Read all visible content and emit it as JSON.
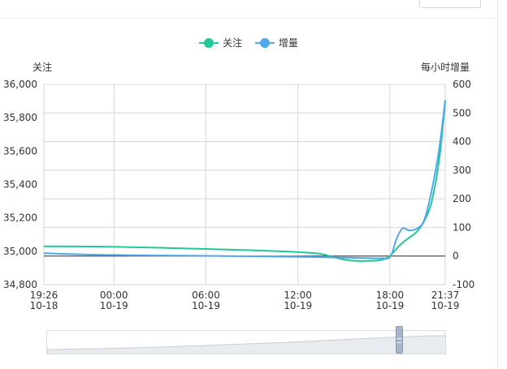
{
  "header": {
    "title": "",
    "button_label": ""
  },
  "legend": [
    {
      "name": "关注",
      "color": "#20c997"
    },
    {
      "name": "增量",
      "color": "#4fa8e8"
    }
  ],
  "colors": {
    "followers": "#20c997",
    "increment": "#4fa8e8",
    "grid": "#d6d6d6",
    "zero_line": "#333333",
    "zoom_fill": "#e8ebef"
  },
  "chart_data": {
    "type": "line",
    "left_axis": {
      "title": "关注",
      "min": 34800,
      "max": 36000,
      "ticks": [
        "34,800",
        "35,000",
        "35,200",
        "35,400",
        "35,600",
        "35,800",
        "36,000"
      ]
    },
    "right_axis": {
      "title": "每小时增量",
      "min": -100,
      "max": 600,
      "ticks": [
        "-100",
        "0",
        "100",
        "200",
        "300",
        "400",
        "500",
        "600"
      ]
    },
    "x_ticks": [
      {
        "time": "19:26",
        "date": "10-18",
        "hour": 0
      },
      {
        "time": "00:00",
        "date": "10-19",
        "hour": 4.57
      },
      {
        "time": "06:00",
        "date": "10-19",
        "hour": 10.57
      },
      {
        "time": "12:00",
        "date": "10-19",
        "hour": 16.57
      },
      {
        "time": "18:00",
        "date": "10-19",
        "hour": 22.57
      },
      {
        "time": "21:37",
        "date": "10-19",
        "hour": 26.18
      }
    ],
    "x_range": [
      0,
      26.18
    ],
    "series": [
      {
        "name": "关注",
        "axis": "left",
        "color": "#20c997",
        "points": [
          [
            0,
            35030
          ],
          [
            4,
            35028
          ],
          [
            8,
            35020
          ],
          [
            12,
            35010
          ],
          [
            16,
            34998
          ],
          [
            18,
            34985
          ],
          [
            19,
            34962
          ],
          [
            20,
            34945
          ],
          [
            21,
            34942
          ],
          [
            22,
            34948
          ],
          [
            22.6,
            34975
          ],
          [
            23.2,
            35035
          ],
          [
            23.8,
            35080
          ],
          [
            24.3,
            35115
          ],
          [
            24.8,
            35180
          ],
          [
            25.3,
            35300
          ],
          [
            25.8,
            35560
          ],
          [
            26.18,
            35900
          ]
        ]
      },
      {
        "name": "增量",
        "axis": "right",
        "color": "#4fa8e8",
        "points": [
          [
            0,
            10
          ],
          [
            3,
            5
          ],
          [
            6,
            3
          ],
          [
            10,
            1
          ],
          [
            14,
            -1
          ],
          [
            17,
            -3
          ],
          [
            19,
            -5
          ],
          [
            21,
            -7
          ],
          [
            22,
            -8
          ],
          [
            22.6,
            -2
          ],
          [
            23,
            60
          ],
          [
            23.4,
            97
          ],
          [
            23.8,
            90
          ],
          [
            24.3,
            95
          ],
          [
            24.8,
            125
          ],
          [
            25.3,
            230
          ],
          [
            25.8,
            380
          ],
          [
            26.18,
            545
          ]
        ]
      }
    ],
    "grid": true,
    "legend_position": "top-center"
  }
}
